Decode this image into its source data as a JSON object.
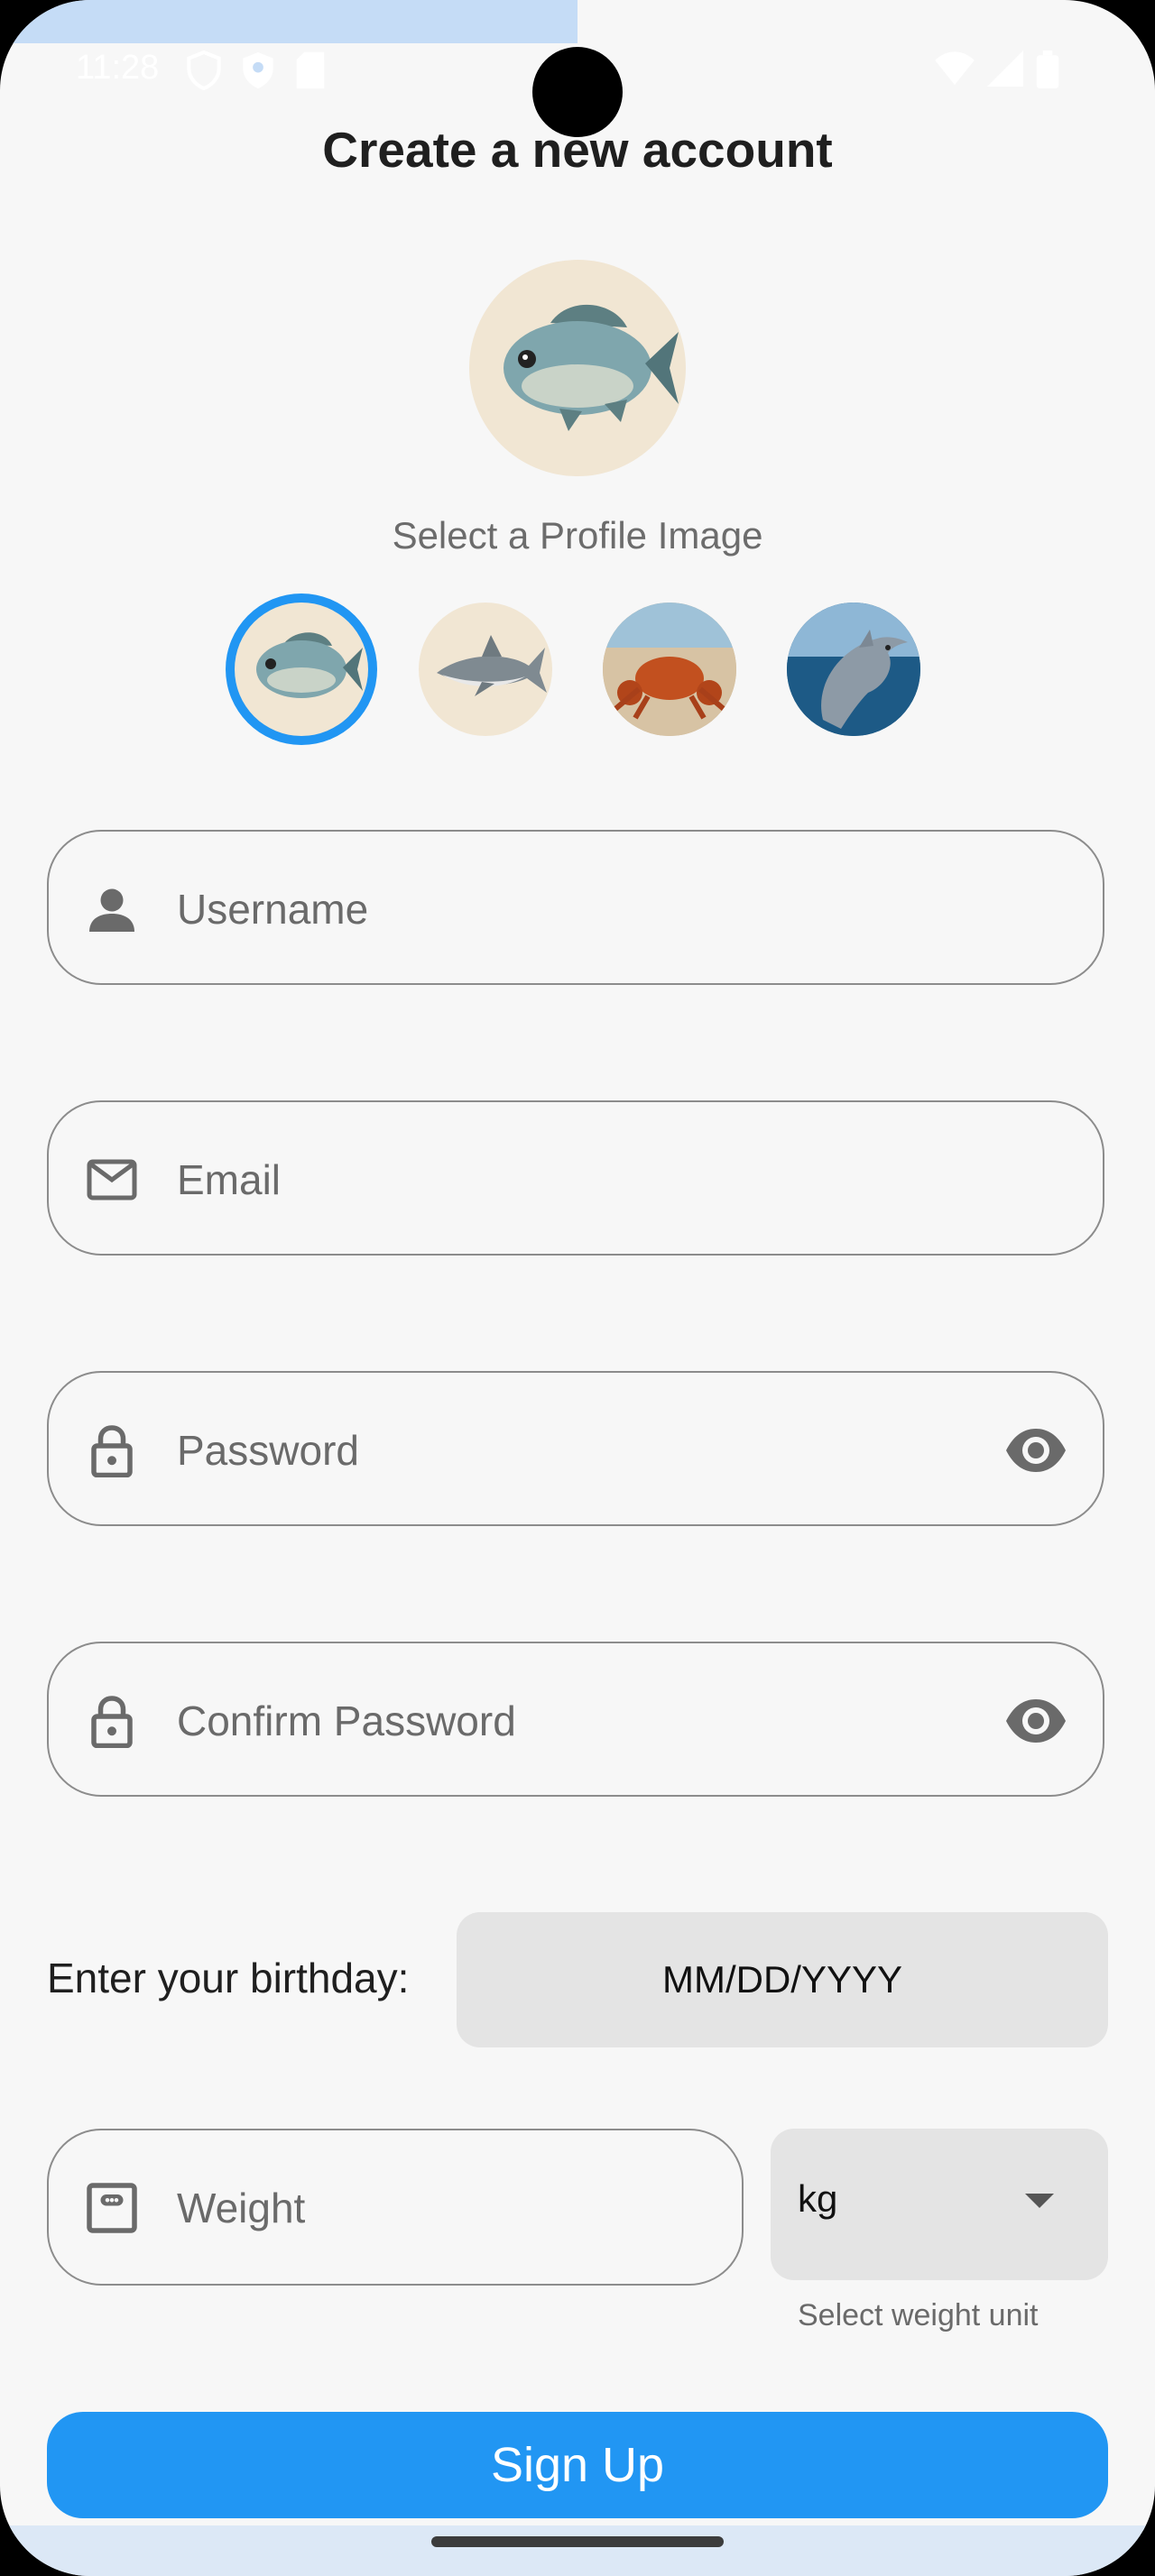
{
  "status_bar": {
    "time": "11:28"
  },
  "screen": {
    "title": "Create a new account",
    "profile": {
      "select_label": "Select a Profile Image",
      "selected_index": 0,
      "options": [
        "fish-image",
        "shark-image",
        "crab-image",
        "dolphin-image"
      ]
    },
    "fields": {
      "username_placeholder": "Username",
      "email_placeholder": "Email",
      "password_placeholder": "Password",
      "confirm_password_placeholder": "Confirm Password"
    },
    "birthday": {
      "label": "Enter your birthday:",
      "value": "MM/DD/YYYY"
    },
    "weight": {
      "placeholder": "Weight",
      "unit_value": "kg",
      "unit_helper": "Select weight unit"
    },
    "signup_label": "Sign Up"
  },
  "colors": {
    "accent": "#2196f3",
    "background": "#f7f7f7",
    "field_border": "#8c8c8c",
    "button_fill": "#e4e4e4"
  }
}
